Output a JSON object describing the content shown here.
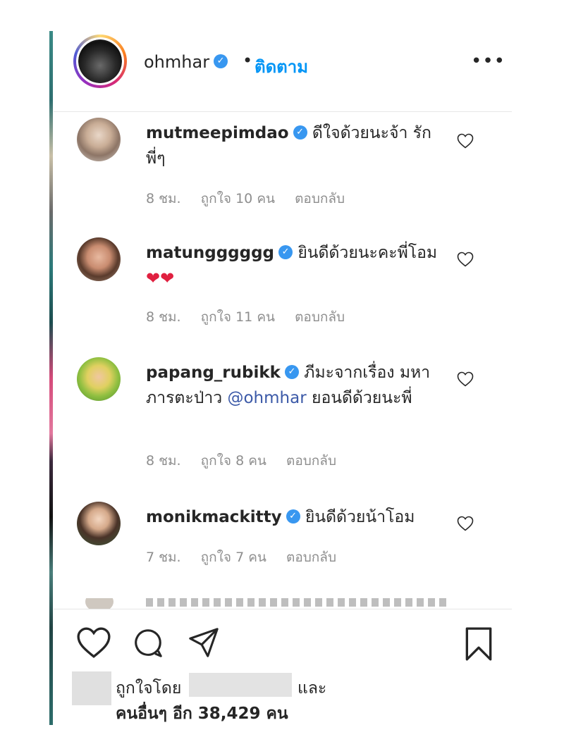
{
  "header": {
    "username": "ohmhar",
    "separator": "•",
    "follow_label": "ติดตาม",
    "more_icon": "more-horizontal-icon"
  },
  "comments": [
    {
      "username": "mutmeepimdao",
      "verified": true,
      "text": "ดีใจด้วยนะจ้า รักพี่ๆ",
      "time": "8 ชม.",
      "likes": "ถูกใจ 10 คน",
      "reply": "ตอบกลับ"
    },
    {
      "username": "matungggggg",
      "verified": true,
      "text": "ยินดีด้วยนะคะพี่โอม",
      "emoji": "❤❤",
      "time": "8 ชม.",
      "likes": "ถูกใจ 11 คน",
      "reply": "ตอบกลับ"
    },
    {
      "username": "papang_rubikk",
      "verified": true,
      "text_before": "ภีมะจากเรื่อง มหาภารตะป่าว",
      "mention": "@ohmhar",
      "text_after": "ยอนดีด้วยนะพี่",
      "time": "8 ชม.",
      "likes": "ถูกใจ 8 คน",
      "reply": "ตอบกลับ"
    },
    {
      "username": "monikmackitty",
      "verified": true,
      "text": "ยินดีด้วยน้าโอม",
      "time": "7 ชม.",
      "likes": "ถูกใจ 7 คน",
      "reply": "ตอบกลับ"
    }
  ],
  "footer": {
    "liked_by_prefix": "ถูกใจโดย",
    "and_label": "และ",
    "others_label": "คนอื่นๆ อีก 38,429 คน",
    "icons": [
      "heart-icon",
      "comment-icon",
      "share-icon",
      "bookmark-icon"
    ]
  },
  "colors": {
    "verified": "#3897f0",
    "follow": "#0095f6",
    "meta_gray": "#8e8e8e",
    "mention": "#3c5aa8"
  }
}
